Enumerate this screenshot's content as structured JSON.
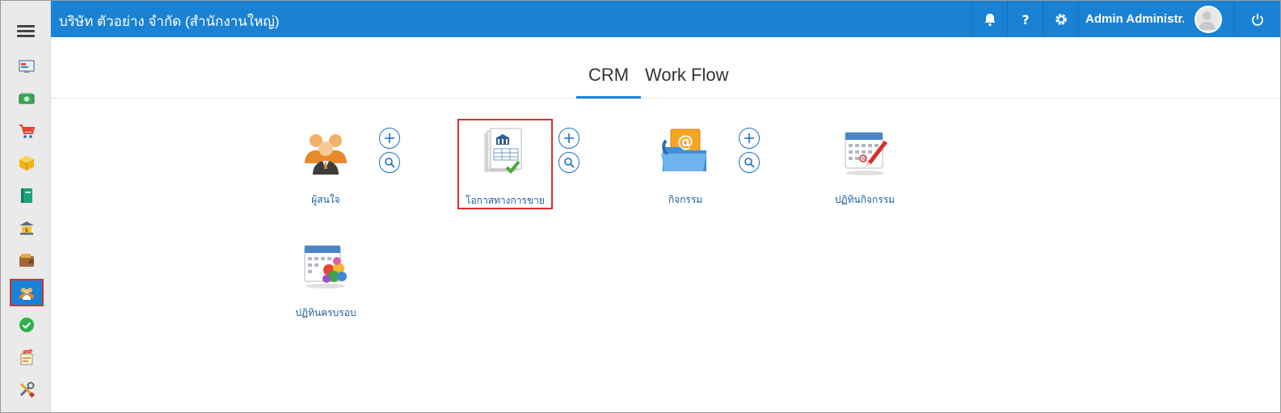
{
  "header": {
    "company": "บริษัท ตัวอย่าง จำกัด (สำนักงานใหญ่)",
    "user_name": "Admin Administr..."
  },
  "tabs": [
    {
      "label": "CRM"
    },
    {
      "label": "Work Flow"
    }
  ],
  "active_tab": "CRM",
  "modules": [
    {
      "label": "ผู้สนใจ",
      "icon": "people-group-icon"
    },
    {
      "label": "โอกาสทางการขาย",
      "icon": "sales-document-icon"
    },
    {
      "label": "กิจกรรม",
      "icon": "email-folder-icon"
    },
    {
      "label": "ปฏิทินกิจกรรม",
      "icon": "calendar-edit-icon"
    },
    {
      "label": "ปฏิทินครบรอบ",
      "icon": "calendar-balloons-icon"
    }
  ],
  "sidebar": {
    "items": [
      "dashboard-icon",
      "money-icon",
      "cart-icon",
      "box-icon",
      "book-icon",
      "bank-icon",
      "wallet-icon",
      "crm-people-icon",
      "check-circle-icon",
      "transfer-icon",
      "tools-icon"
    ],
    "active": "crm-people-icon"
  },
  "colors": {
    "primary": "#1a82d4",
    "highlight_border": "#d32f2f",
    "sidebar_bg": "#eaeaea"
  }
}
